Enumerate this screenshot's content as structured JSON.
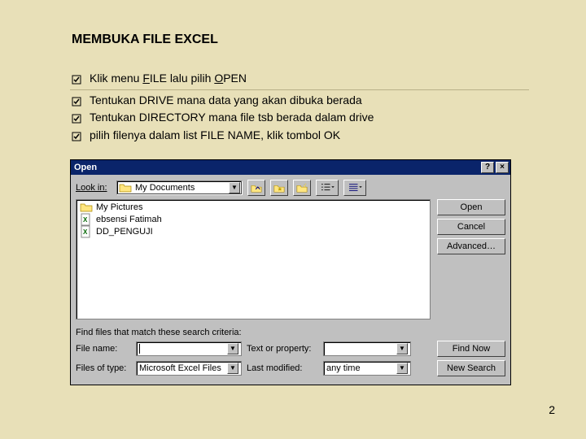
{
  "slide": {
    "title": "MEMBUKA FILE EXCEL",
    "bullets": [
      {
        "pre": "Klik menu ",
        "u1": "F",
        "mid": "ILE lalu pilih ",
        "u2": "O",
        "post": "PEN"
      },
      {
        "text": "Tentukan DRIVE mana data yang akan dibuka berada"
      },
      {
        "text": "Tentukan DIRECTORY mana file tsb berada dalam drive"
      },
      {
        "text": "pilih filenya dalam list FILE NAME, klik tombol OK"
      }
    ],
    "page_number": "2"
  },
  "dialog": {
    "title": "Open",
    "help_glyph": "?",
    "close_glyph": "×",
    "look_in_label": "Look in:",
    "look_in_value": "My Documents",
    "files": [
      {
        "icon": "folder",
        "name": "My Pictures"
      },
      {
        "icon": "excel",
        "name": "ebsensi Fatimah"
      },
      {
        "icon": "excel",
        "name": "DD_PENGUJI"
      }
    ],
    "buttons": {
      "open": "Open",
      "cancel": "Cancel",
      "advanced": "Advanced…"
    },
    "criteria_label": "Find files that match these search criteria:",
    "filename_label": "File name:",
    "filename_value": "",
    "textprop_label": "Text or property:",
    "textprop_value": "",
    "filetype_label": "Files of type:",
    "filetype_value": "Microsoft Excel Files",
    "lastmod_label": "Last modified:",
    "lastmod_value": "any time",
    "find_now": "Find Now",
    "new_search": "New Search"
  }
}
